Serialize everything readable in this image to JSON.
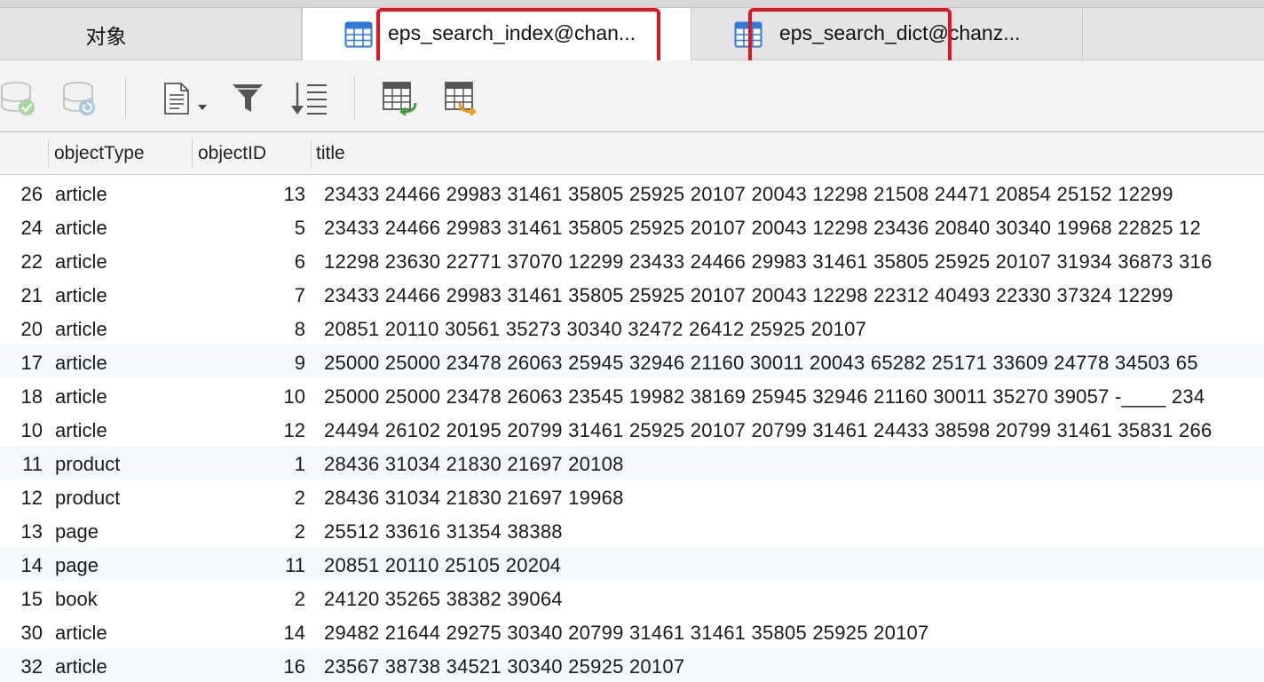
{
  "tabs": {
    "objects": "对象",
    "index": "eps_search_index@chan...",
    "dict": "eps_search_dict@chanz..."
  },
  "toolbar": {
    "buttons": [
      "apply-changes",
      "discard-changes",
      "text-view",
      "filter",
      "sort",
      "import",
      "export"
    ]
  },
  "grid": {
    "columns": [
      "objectType",
      "objectID",
      "title"
    ],
    "rows": [
      {
        "id": "26",
        "type": "article",
        "oid": "13",
        "title": "23433 24466 29983 31461 35805 25925 20107 20043 12298 21508 24471 20854 25152 12299"
      },
      {
        "id": "24",
        "type": "article",
        "oid": "5",
        "title": "23433 24466 29983 31461 35805 25925 20107 20043 12298 23436 20840 30340 19968 22825 12"
      },
      {
        "id": "22",
        "type": "article",
        "oid": "6",
        "title": "12298 23630 22771 37070 12299 23433 24466 29983 31461 35805 25925 20107 31934 36873 316"
      },
      {
        "id": "21",
        "type": "article",
        "oid": "7",
        "title": "23433 24466 29983 31461 35805 25925 20107 20043 12298 22312 40493 22330 37324 12299"
      },
      {
        "id": "20",
        "type": "article",
        "oid": "8",
        "title": "20851 20110 30561 35273 30340 32472 26412 25925 20107"
      },
      {
        "id": "17",
        "type": "article",
        "oid": "9",
        "title": "25000 25000 23478 26063 25945 32946 21160 30011 20043 65282 25171 33609 24778 34503 65"
      },
      {
        "id": "18",
        "type": "article",
        "oid": "10",
        "title": "25000 25000 23478 26063 23545 19982 38169 25945 32946 21160 30011 35270 39057 -____ 234"
      },
      {
        "id": "10",
        "type": "article",
        "oid": "12",
        "title": "24494 26102 20195 20799 31461 25925 20107 20799 31461 24433 38598 20799 31461 35831 266"
      },
      {
        "id": "11",
        "type": "product",
        "oid": "1",
        "title": "28436 31034 21830 21697 20108"
      },
      {
        "id": "12",
        "type": "product",
        "oid": "2",
        "title": "28436 31034 21830 21697 19968"
      },
      {
        "id": "13",
        "type": "page",
        "oid": "2",
        "title": "25512 33616 31354 38388"
      },
      {
        "id": "14",
        "type": "page",
        "oid": "11",
        "title": "20851 20110 25105 20204"
      },
      {
        "id": "15",
        "type": "book",
        "oid": "2",
        "title": "24120 35265 38382 39064"
      },
      {
        "id": "30",
        "type": "article",
        "oid": "14",
        "title": "29482 21644 29275 30340 20799 31461 31461 35805 25925 20107"
      },
      {
        "id": "32",
        "type": "article",
        "oid": "16",
        "title": "23567 38738 34521 30340 25925 20107"
      }
    ]
  }
}
